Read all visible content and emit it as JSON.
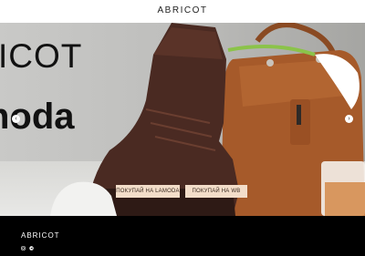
{
  "header": {
    "brand": "ABRICOT"
  },
  "hero": {
    "line1": "ICOT",
    "line2": "noda",
    "buttons": {
      "lamoda": "ПОКУПАЙ НА LAMODA",
      "wb": "ПОКУПАЙ НА WB"
    }
  },
  "footer": {
    "brand": "ABRICOT"
  }
}
